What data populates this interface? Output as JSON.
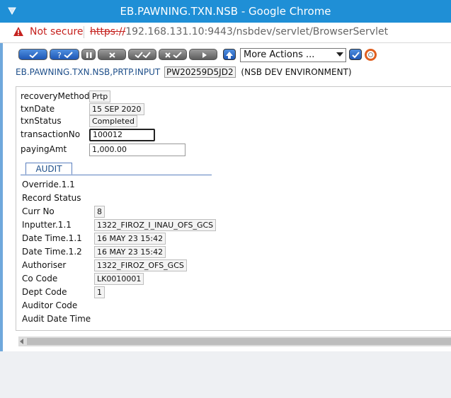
{
  "window": {
    "title": "EB.PAWNING.TXN.NSB - Google Chrome"
  },
  "address": {
    "security_label": "Not secure",
    "scheme": "https://",
    "url_rest": "192.168.131.10:9443/nsbdev/servlet/BrowserServlet"
  },
  "toolbar": {
    "more_actions": "More Actions ..."
  },
  "app": {
    "name": "EB.PAWNING.TXN.NSB,PRTP.INPUT",
    "record_id": "PW20259D5JD2",
    "environment": "(NSB DEV ENVIRONMENT)"
  },
  "fields": [
    {
      "label": "recoveryMethod",
      "value": "Prtp"
    },
    {
      "label": "txnDate",
      "value": "15 SEP 2020"
    },
    {
      "label": "txnStatus",
      "value": "Completed"
    },
    {
      "label": "transactionNo",
      "value": "100012"
    },
    {
      "label": "payingAmt",
      "value": "1,000.00"
    }
  ],
  "audit_tab": {
    "label": "AUDIT"
  },
  "audit": [
    {
      "label": "Override.1.1",
      "value": ""
    },
    {
      "label": "Record Status",
      "value": ""
    },
    {
      "label": "Curr No",
      "value": "8"
    },
    {
      "label": "Inputter.1.1",
      "value": "1322_FIROZ_I_INAU_OFS_GCS"
    },
    {
      "label": "Date Time.1.1",
      "value": "16 MAY 23 15:42"
    },
    {
      "label": "Date Time.1.2",
      "value": "16 MAY 23 15:42"
    },
    {
      "label": "Authoriser",
      "value": "1322_FIROZ_OFS_GCS"
    },
    {
      "label": "Co Code",
      "value": "LK0010001"
    },
    {
      "label": "Dept Code",
      "value": "1"
    },
    {
      "label": "Auditor Code",
      "value": ""
    },
    {
      "label": "Audit Date Time",
      "value": ""
    }
  ]
}
